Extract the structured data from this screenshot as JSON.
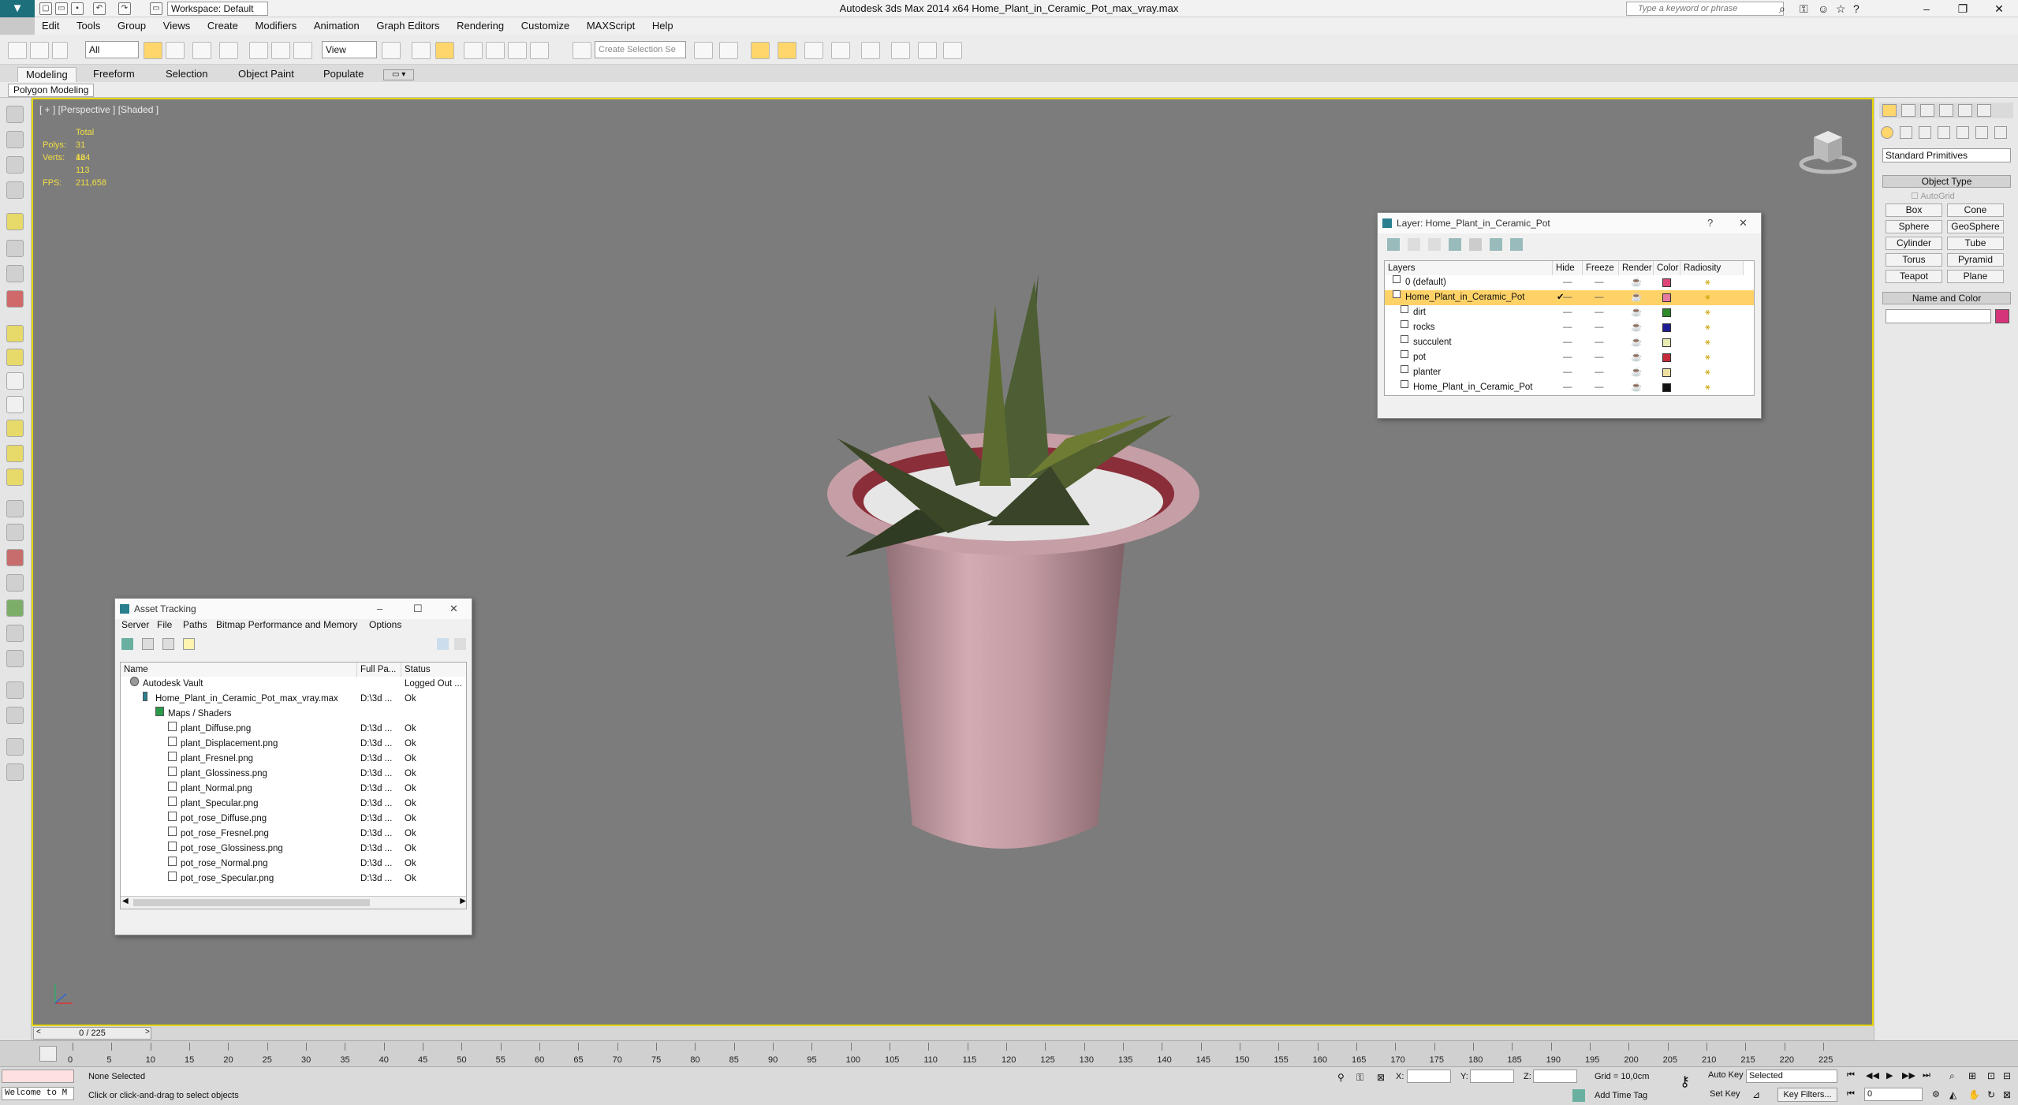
{
  "titlebar": {
    "workspace": "Workspace: Default",
    "title": "Autodesk 3ds Max  2014 x64     Home_Plant_in_Ceramic_Pot_max_vray.max",
    "search_placeholder": "Type a keyword or phrase"
  },
  "menu": [
    "Edit",
    "Tools",
    "Group",
    "Views",
    "Create",
    "Modifiers",
    "Animation",
    "Graph Editors",
    "Rendering",
    "Customize",
    "MAXScript",
    "Help"
  ],
  "toolbar": {
    "filter": "All",
    "ref_coord": "View",
    "selection_set": "Create Selection Se"
  },
  "ribbon": {
    "tabs": [
      "Modeling",
      "Freeform",
      "Selection",
      "Object Paint",
      "Populate"
    ],
    "active_tab": "Modeling",
    "sub_label": "Polygon Modeling"
  },
  "viewport": {
    "label": "[ + ] [Perspective ] [Shaded ]",
    "stats": {
      "total_label": "Total",
      "polys_label": "Polys:",
      "polys": "31 424",
      "verts_label": "Verts:",
      "verts": "16 113",
      "fps_label": "FPS:",
      "fps": "211,658"
    }
  },
  "layer_window": {
    "title": "Layer: Home_Plant_in_Ceramic_Pot",
    "help": "?",
    "columns": [
      "Layers",
      "Hide",
      "Freeze",
      "Render",
      "Color",
      "Radiosity"
    ],
    "rows": [
      {
        "name": "0 (default)",
        "level": 0,
        "color": "#e0457a"
      },
      {
        "name": "Home_Plant_in_Ceramic_Pot",
        "level": 0,
        "color": "#e67aa0",
        "selected": true
      },
      {
        "name": "dirt",
        "level": 1,
        "color": "#2f8a2c"
      },
      {
        "name": "rocks",
        "level": 1,
        "color": "#1d1c92"
      },
      {
        "name": "succulent",
        "level": 1,
        "color": "#e8ecb1"
      },
      {
        "name": "pot",
        "level": 1,
        "color": "#c42a3a"
      },
      {
        "name": "planter",
        "level": 1,
        "color": "#eee0a0"
      },
      {
        "name": "Home_Plant_in_Ceramic_Pot",
        "level": 1,
        "color": "#111111"
      }
    ],
    "hide_mark": "—",
    "freeze_mark": "—",
    "render_mark": "☕",
    "radiosity_mark": "⚹"
  },
  "asset_window": {
    "title": "Asset Tracking",
    "menu": [
      "Server",
      "File",
      "Paths",
      "Bitmap Performance and Memory",
      "Options"
    ],
    "columns": [
      "Name",
      "Full Pa...",
      "Status"
    ],
    "rows": [
      {
        "name": "Autodesk Vault",
        "path": "",
        "status": "Logged Out ...",
        "level": 0
      },
      {
        "name": "Home_Plant_in_Ceramic_Pot_max_vray.max",
        "path": "D:\\3d ...",
        "status": "Ok",
        "level": 1
      },
      {
        "name": "Maps / Shaders",
        "path": "",
        "status": "",
        "level": 2
      },
      {
        "name": "plant_Diffuse.png",
        "path": "D:\\3d ...",
        "status": "Ok",
        "level": 3
      },
      {
        "name": "plant_Displacement.png",
        "path": "D:\\3d ...",
        "status": "Ok",
        "level": 3
      },
      {
        "name": "plant_Fresnel.png",
        "path": "D:\\3d ...",
        "status": "Ok",
        "level": 3
      },
      {
        "name": "plant_Glossiness.png",
        "path": "D:\\3d ...",
        "status": "Ok",
        "level": 3
      },
      {
        "name": "plant_Normal.png",
        "path": "D:\\3d ...",
        "status": "Ok",
        "level": 3
      },
      {
        "name": "plant_Specular.png",
        "path": "D:\\3d ...",
        "status": "Ok",
        "level": 3
      },
      {
        "name": "pot_rose_Diffuse.png",
        "path": "D:\\3d ...",
        "status": "Ok",
        "level": 3
      },
      {
        "name": "pot_rose_Fresnel.png",
        "path": "D:\\3d ...",
        "status": "Ok",
        "level": 3
      },
      {
        "name": "pot_rose_Glossiness.png",
        "path": "D:\\3d ...",
        "status": "Ok",
        "level": 3
      },
      {
        "name": "pot_rose_Normal.png",
        "path": "D:\\3d ...",
        "status": "Ok",
        "level": 3
      },
      {
        "name": "pot_rose_Specular.png",
        "path": "D:\\3d ...",
        "status": "Ok",
        "level": 3
      }
    ]
  },
  "command_panel": {
    "category": "Standard Primitives",
    "object_type_title": "Object Type",
    "autogrid": "AutoGrid",
    "buttons": [
      "Box",
      "Cone",
      "Sphere",
      "GeoSphere",
      "Cylinder",
      "Tube",
      "Torus",
      "Pyramid",
      "Teapot",
      "Plane"
    ],
    "name_color_title": "Name and Color",
    "object_color": "#d6347a"
  },
  "timeline": {
    "frame_display": "0 / 225",
    "ticks": [
      "0",
      "5",
      "10",
      "15",
      "20",
      "25",
      "30",
      "35",
      "40",
      "45",
      "50",
      "55",
      "60",
      "65",
      "70",
      "75",
      "80",
      "85",
      "90",
      "95",
      "100",
      "105",
      "110",
      "115",
      "120",
      "125",
      "130",
      "135",
      "140",
      "145",
      "150",
      "155",
      "160",
      "165",
      "170",
      "175",
      "180",
      "185",
      "190",
      "195",
      "200",
      "205",
      "210",
      "215",
      "220",
      "225"
    ]
  },
  "status": {
    "welcome": "Welcome to M",
    "selection": "None Selected",
    "prompt": "Click or click-and-drag to select objects",
    "x_label": "X:",
    "y_label": "Y:",
    "z_label": "Z:",
    "grid": "Grid = 10,0cm",
    "add_time_tag": "Add Time Tag",
    "auto_key": "Auto Key",
    "set_key": "Set Key",
    "selected": "Selected",
    "key_filters": "Key Filters...",
    "frame": "0"
  }
}
